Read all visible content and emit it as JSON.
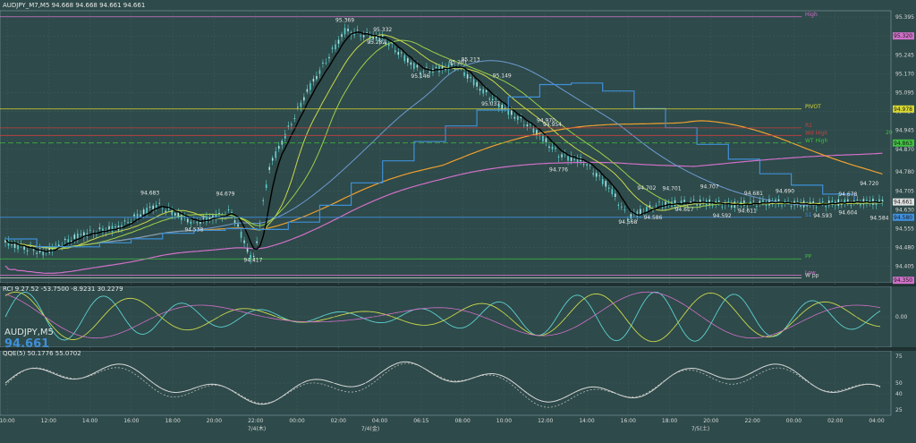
{
  "header": {
    "main": "AUDJPY_M7,M5  94.668 94.668 94.661 94.661",
    "rci": "RCI 9.27.52  -53.7500 -8.9231 30.2279",
    "qqe": "QQE(5) 50.1776 55.0702",
    "symbol_big": "AUDJPY,M5",
    "price_big": "94.661"
  },
  "colors": {
    "bg": "#2e4a4a",
    "grid": "#3d5c5c",
    "ema_fast": "#000000",
    "sma_green": "#9ad04a",
    "sma_yellow": "#c9d84a",
    "ma_blue": "#6c9bd1",
    "ma_orange": "#f0a030",
    "ma_pink": "#d070c8",
    "step_blue": "#3f8fd8",
    "candle": "#5ed0d0"
  },
  "chart_data": [
    {
      "type": "line",
      "title": "",
      "x_ticks": [
        "10:00",
        "12:00",
        "14:00",
        "16:00",
        "18:00",
        "20:00",
        "22:00",
        "00:00",
        "02:00",
        "04:00",
        "06:15",
        "08:00",
        "10:00",
        "12:00",
        "14:00",
        "16:00",
        "18:00",
        "20:00",
        "22:00",
        "00:00",
        "02:00",
        "04:00"
      ],
      "x_dates": [
        "7/4(木)",
        "7/4(金)",
        "7/5(土)"
      ],
      "y_ticks": [
        "95.395",
        "95.320",
        "95.245",
        "95.170",
        "95.095",
        "95.020",
        "94.945",
        "94.870",
        "94.780",
        "94.705",
        "94.630",
        "94.555",
        "94.480",
        "94.405"
      ],
      "ylim": [
        94.34,
        95.42
      ],
      "price_labels": [
        {
          "label": "95.369",
          "x": 27,
          "y": 95.369
        },
        {
          "label": "95.332",
          "x": 30,
          "y": 95.332
        },
        {
          "label": "95.282",
          "x": 29.5,
          "y": 95.282
        },
        {
          "label": "95.213",
          "x": 37,
          "y": 95.213
        },
        {
          "label": "95.201",
          "x": 36,
          "y": 95.201
        },
        {
          "label": "95.146",
          "x": 33,
          "y": 95.146
        },
        {
          "label": "95.149",
          "x": 39.5,
          "y": 95.149
        },
        {
          "label": "95.037",
          "x": 38.6,
          "y": 95.037
        },
        {
          "label": "94.954",
          "x": 43.5,
          "y": 94.954
        },
        {
          "label": "94.970",
          "x": 43,
          "y": 94.97
        },
        {
          "label": "94.776",
          "x": 44,
          "y": 94.776
        },
        {
          "label": "94.683",
          "x": 11.5,
          "y": 94.683
        },
        {
          "label": "94.679",
          "x": 17.5,
          "y": 94.679
        },
        {
          "label": "94.538",
          "x": 15,
          "y": 94.538
        },
        {
          "label": "94.417",
          "x": 19.7,
          "y": 94.417
        },
        {
          "label": "94.702",
          "x": 51,
          "y": 94.702
        },
        {
          "label": "94.701",
          "x": 53,
          "y": 94.701
        },
        {
          "label": "94.707",
          "x": 56,
          "y": 94.707
        },
        {
          "label": "94.681",
          "x": 59.5,
          "y": 94.681
        },
        {
          "label": "94.690",
          "x": 62,
          "y": 94.69
        },
        {
          "label": "94.678",
          "x": 67,
          "y": 94.678
        },
        {
          "label": "94.720",
          "x": 68.7,
          "y": 94.72
        },
        {
          "label": "94.568",
          "x": 49.5,
          "y": 94.568
        },
        {
          "label": "94.586",
          "x": 51.5,
          "y": 94.586
        },
        {
          "label": "94.617",
          "x": 54,
          "y": 94.617
        },
        {
          "label": "94.592",
          "x": 57,
          "y": 94.592
        },
        {
          "label": "94.611",
          "x": 59,
          "y": 94.611
        },
        {
          "label": "94.593",
          "x": 65,
          "y": 94.593
        },
        {
          "label": "94.604",
          "x": 67,
          "y": 94.604
        },
        {
          "label": "94.584",
          "x": 69.5,
          "y": 94.584
        }
      ],
      "levels": [
        {
          "label": "High",
          "y": 95.396,
          "color": "#d070c8"
        },
        {
          "label": "PIVOT",
          "y": 95.03,
          "color": "#d8d830"
        },
        {
          "label": "R1",
          "y": 94.955,
          "color": "#c84040"
        },
        {
          "label": "Wd High",
          "y": 94.925,
          "color": "#c84040"
        },
        {
          "label": "WT High",
          "y": 94.895,
          "color": "#40c040"
        },
        {
          "label": "S1",
          "y": 94.6,
          "color": "#4090e0"
        },
        {
          "label": "PP",
          "y": 94.435,
          "color": "#40c040"
        },
        {
          "label": "Low",
          "y": 94.37,
          "color": "#d070c8"
        },
        {
          "label": "W pp",
          "y": 94.36,
          "color": "#d8d8d8"
        }
      ],
      "right_boxes": [
        {
          "label": "95.320",
          "y": 95.32,
          "color": "#d070c8"
        },
        {
          "label": "94.978",
          "y": 95.03,
          "color": "#d8d830"
        },
        {
          "label": "94.863",
          "y": 94.895,
          "color": "#40c040"
        },
        {
          "label": "94.661",
          "y": 94.661,
          "color": "#e0e0e0"
        },
        {
          "label": "94.580",
          "y": 94.6,
          "color": "#4090e0"
        },
        {
          "label": "94.350",
          "y": 94.35,
          "color": "#d070c8"
        }
      ],
      "right_side_label": "20"
    },
    {
      "type": "line",
      "title": "",
      "ylim": [
        -110,
        110
      ],
      "y_ticks": [
        "0.00"
      ]
    },
    {
      "type": "line",
      "title": "",
      "ylim": [
        20,
        80
      ],
      "y_ticks": [
        "75",
        "50",
        "40",
        "25"
      ]
    }
  ]
}
